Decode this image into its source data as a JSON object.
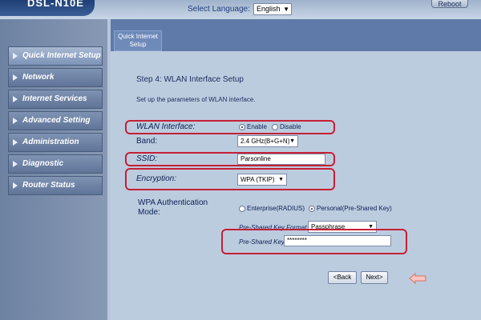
{
  "header": {
    "model": "DSL-N10E",
    "select_language_label": "Select Language:",
    "language": "English",
    "reboot_label": "Reboot"
  },
  "sidebar": {
    "items": [
      {
        "label": "Quick Internet Setup"
      },
      {
        "label": "Network"
      },
      {
        "label": "Internet Services"
      },
      {
        "label": "Advanced Setting"
      },
      {
        "label": "Administration"
      },
      {
        "label": "Diagnostic"
      },
      {
        "label": "Router Status"
      }
    ]
  },
  "tab": {
    "line1": "Quick Internet",
    "line2": "Setup"
  },
  "step": {
    "title": "Step 4: WLAN Interface Setup",
    "description": "Set up the parameters of WLAN interface."
  },
  "form": {
    "wlan_interface_label": "WLAN Interface:",
    "enable_label": "Enable",
    "disable_label": "Disable",
    "band_label": "Band:",
    "band_value": "2.4 GHz(B+G+N)",
    "ssid_label": "SSID:",
    "ssid_value": "Parsonline",
    "encryption_label": "Encryption:",
    "encryption_value": "WPA (TKIP)",
    "wpa_auth_label_1": "WPA Authentication",
    "wpa_auth_label_2": "Mode:",
    "enterprise_label": "Enterprise(RADIUS)",
    "personal_label": "Personal(Pre-Shared Key)",
    "psk_format_label": "Pre-Shared Key Format:",
    "psk_format_value": "Passphrase",
    "psk_label": "Pre-Shared Key:",
    "psk_value": "********"
  },
  "buttons": {
    "back": "<Back",
    "next": "Next>"
  }
}
